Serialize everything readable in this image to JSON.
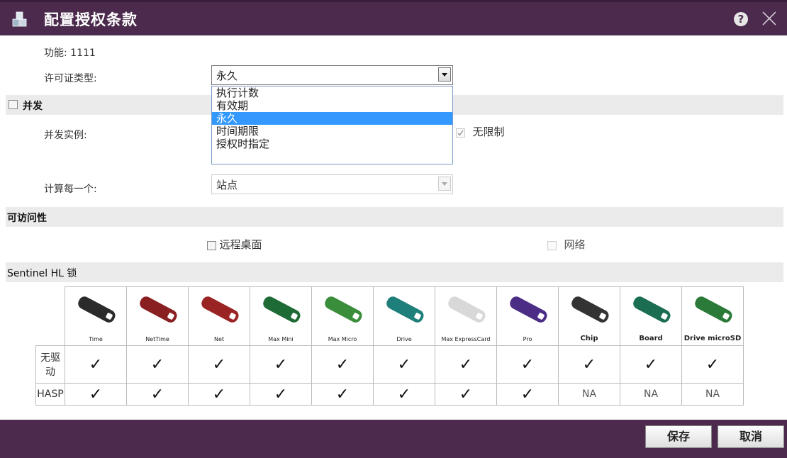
{
  "dialog": {
    "title": "配置授权条款"
  },
  "fields": {
    "feature_label": "功能:",
    "feature_value": "1111",
    "license_type_label": "许可证类型:",
    "license_type_value": "永久",
    "license_type_options": [
      "执行计数",
      "有效期",
      "永久",
      "时间期限",
      "授权时指定"
    ],
    "license_type_selected_index": 2
  },
  "concurrency": {
    "section_title": "并发",
    "instances_label": "并发实例:",
    "unlimited_label": "无限制",
    "count_each_label": "计算每一个:",
    "count_each_value": "站点"
  },
  "accessibility": {
    "section_title": "可访问性",
    "remote_desktop_label": "远程桌面",
    "network_label": "网络"
  },
  "sentinel": {
    "section_title": "Sentinel HL 锁",
    "keys": [
      {
        "name": "Time",
        "color": "#2b2b2b",
        "bold": false
      },
      {
        "name": "NetTime",
        "color": "#8a1f22",
        "bold": false
      },
      {
        "name": "Net",
        "color": "#9a2424",
        "bold": false
      },
      {
        "name": "Max Mini",
        "color": "#1f6b35",
        "bold": false
      },
      {
        "name": "Max Micro",
        "color": "#3a8d3a",
        "bold": false
      },
      {
        "name": "Drive",
        "color": "#1f7f7a",
        "bold": false
      },
      {
        "name": "Max ExpressCard",
        "color": "#d8d8d8",
        "bold": false
      },
      {
        "name": "Pro",
        "color": "#4b2d86",
        "bold": false
      },
      {
        "name": "Chip",
        "color": "#333333",
        "bold": true
      },
      {
        "name": "Board",
        "color": "#1b6e52",
        "bold": true
      },
      {
        "name": "Drive microSD",
        "color": "#2b7a3a",
        "bold": true
      }
    ],
    "rows": [
      {
        "label": "无驱动",
        "values": [
          "✓",
          "✓",
          "✓",
          "✓",
          "✓",
          "✓",
          "✓",
          "✓",
          "✓",
          "✓",
          "✓"
        ]
      },
      {
        "label": "HASP",
        "values": [
          "✓",
          "✓",
          "✓",
          "✓",
          "✓",
          "✓",
          "✓",
          "✓",
          "NA",
          "NA",
          "NA"
        ]
      }
    ]
  },
  "footer": {
    "save_label": "保存",
    "cancel_label": "取消"
  }
}
